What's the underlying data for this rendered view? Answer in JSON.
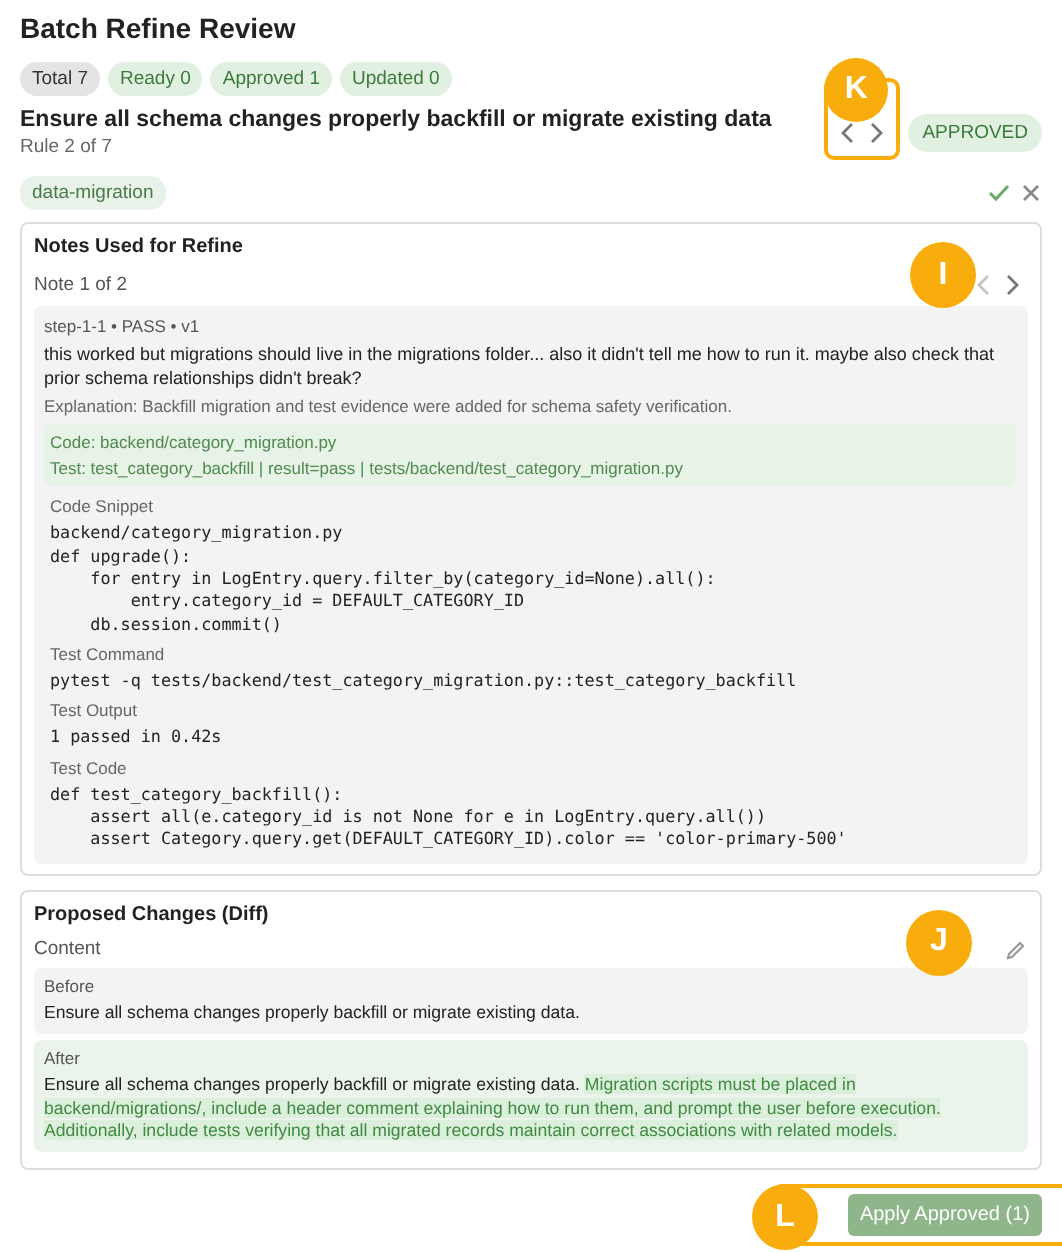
{
  "title": "Batch Refine Review",
  "chips": [
    {
      "label": "Total 7",
      "kind": "neutral"
    },
    {
      "label": "Ready 0",
      "kind": "success"
    },
    {
      "label": "Approved 1",
      "kind": "success"
    },
    {
      "label": "Updated 0",
      "kind": "success"
    }
  ],
  "rule": {
    "callout": "K",
    "title": "Ensure all schema changes properly backfill or migrate existing data",
    "subtitle": "Rule 2 of 7",
    "status": "APPROVED",
    "tag": "data-migration",
    "prev_disabled": false,
    "next_disabled": false
  },
  "notes": {
    "callout": "I",
    "title": "Notes Used for Refine",
    "counter": "Note 1 of 2",
    "prev_disabled": true,
    "next_disabled": false,
    "meta": "step-1-1 • PASS • v1",
    "text": "this worked but migrations should live in the migrations folder... also it didn't tell me how to run it. maybe also check that prior schema relationships didn't break?",
    "explanation": "Explanation: Backfill migration and test evidence were added for schema safety verification.",
    "evidence": [
      "Code: backend/category_migration.py",
      "Test: test_category_backfill | result=pass | tests/backend/test_category_migration.py"
    ],
    "sections": [
      {
        "label": "Code Snippet",
        "code": "backend/category_migration.py\ndef upgrade():\n    for entry in LogEntry.query.filter_by(category_id=None).all():\n        entry.category_id = DEFAULT_CATEGORY_ID\n    db.session.commit()"
      },
      {
        "label": "Test Command",
        "code": "pytest -q tests/backend/test_category_migration.py::test_category_backfill"
      },
      {
        "label": "Test Output",
        "code": "1 passed in 0.42s"
      },
      {
        "label": "Test Code",
        "code": "def test_category_backfill():\n    assert all(e.category_id is not None for e in LogEntry.query.all())\n    assert Category.query.get(DEFAULT_CATEGORY_ID).color == 'color-primary-500'"
      }
    ]
  },
  "diff": {
    "callout": "J",
    "title": "Proposed Changes (Diff)",
    "field": "Content",
    "before": {
      "label": "Before",
      "text": "Ensure all schema changes properly backfill or migrate existing data."
    },
    "after": {
      "label": "After",
      "text": "Ensure all schema changes properly backfill or migrate existing data.",
      "added": "Migration scripts must be placed in backend/migrations/, include a header comment explaining how to run them, and prompt the user before execution. Additionally, include tests verifying that all migrated records maintain correct associations with related models."
    }
  },
  "footer": {
    "callout": "L",
    "apply": "Apply Approved (1)"
  }
}
